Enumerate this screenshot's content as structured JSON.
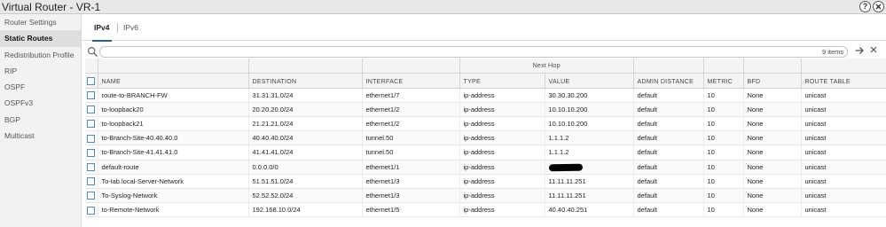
{
  "window": {
    "title": "Virtual Router - VR-1"
  },
  "icons": {
    "help": "help-icon",
    "close": "close-icon",
    "search": "search-icon",
    "arrow": "arrow-right-icon"
  },
  "sidebar": {
    "items": [
      {
        "label": "Router Settings"
      },
      {
        "label": "Static Routes",
        "active": true
      },
      {
        "label": "Redistribution Profile"
      },
      {
        "label": "RIP"
      },
      {
        "label": "OSPF"
      },
      {
        "label": "OSPFv3"
      },
      {
        "label": "BGP"
      },
      {
        "label": "Multicast"
      }
    ]
  },
  "tabs": [
    {
      "label": "IPv4",
      "active": true
    },
    {
      "label": "IPv6"
    }
  ],
  "search": {
    "placeholder": "",
    "value": "",
    "count": "9 items"
  },
  "table": {
    "group_header": "Next Hop",
    "columns": [
      "NAME",
      "DESTINATION",
      "INTERFACE",
      "TYPE",
      "VALUE",
      "ADMIN DISTANCE",
      "METRIC",
      "BFD",
      "ROUTE TABLE"
    ],
    "rows": [
      {
        "name": "route-to-BRANCH-FW",
        "destination": "31.31.31.0/24",
        "interface": "ethernet1/7",
        "type": "ip-address",
        "value": "30.30.30.200",
        "admin_distance": "default",
        "metric": "10",
        "bfd": "None",
        "route_table": "unicast"
      },
      {
        "name": "to-loopback20",
        "destination": "20.20.20.0/24",
        "interface": "ethernet1/2",
        "type": "ip-address",
        "value": "10.10.10.200",
        "admin_distance": "default",
        "metric": "10",
        "bfd": "None",
        "route_table": "unicast"
      },
      {
        "name": "to-loopback21",
        "destination": "21.21.21.0/24",
        "interface": "ethernet1/2",
        "type": "ip-address",
        "value": "10.10.10.200",
        "admin_distance": "default",
        "metric": "10",
        "bfd": "None",
        "route_table": "unicast"
      },
      {
        "name": "to-Branch-Site-40.40.40.0",
        "destination": "40.40.40.0/24",
        "interface": "tunnel.50",
        "type": "ip-address",
        "value": "1.1.1.2",
        "admin_distance": "default",
        "metric": "10",
        "bfd": "None",
        "route_table": "unicast"
      },
      {
        "name": "to-Branch-Site-41.41.41.0",
        "destination": "41.41.41.0/24",
        "interface": "tunnel.50",
        "type": "ip-address",
        "value": "1.1.1.2",
        "admin_distance": "default",
        "metric": "10",
        "bfd": "None",
        "route_table": "unicast"
      },
      {
        "name": "default-route",
        "destination": "0.0.0.0/0",
        "interface": "ethernet1/1",
        "type": "ip-address",
        "value": "",
        "value_redacted": true,
        "admin_distance": "default",
        "metric": "10",
        "bfd": "None",
        "route_table": "unicast"
      },
      {
        "name": "To-lab.local-Server-Network",
        "destination": "51.51.51.0/24",
        "interface": "ethernet1/3",
        "type": "ip-address",
        "value": "11.11.11.251",
        "admin_distance": "default",
        "metric": "10",
        "bfd": "None",
        "route_table": "unicast"
      },
      {
        "name": "To-Syslog-Network",
        "destination": "52.52.52.0/24",
        "interface": "ethernet1/3",
        "type": "ip-address",
        "value": "11.11.11.251",
        "admin_distance": "default",
        "metric": "10",
        "bfd": "None",
        "route_table": "unicast"
      },
      {
        "name": "to-Remote-Network",
        "destination": "192.168.10.0/24",
        "interface": "ethernet1/5",
        "type": "ip-address",
        "value": "40.40.40.251",
        "admin_distance": "default",
        "metric": "10",
        "bfd": "None",
        "route_table": "unicast"
      }
    ]
  }
}
